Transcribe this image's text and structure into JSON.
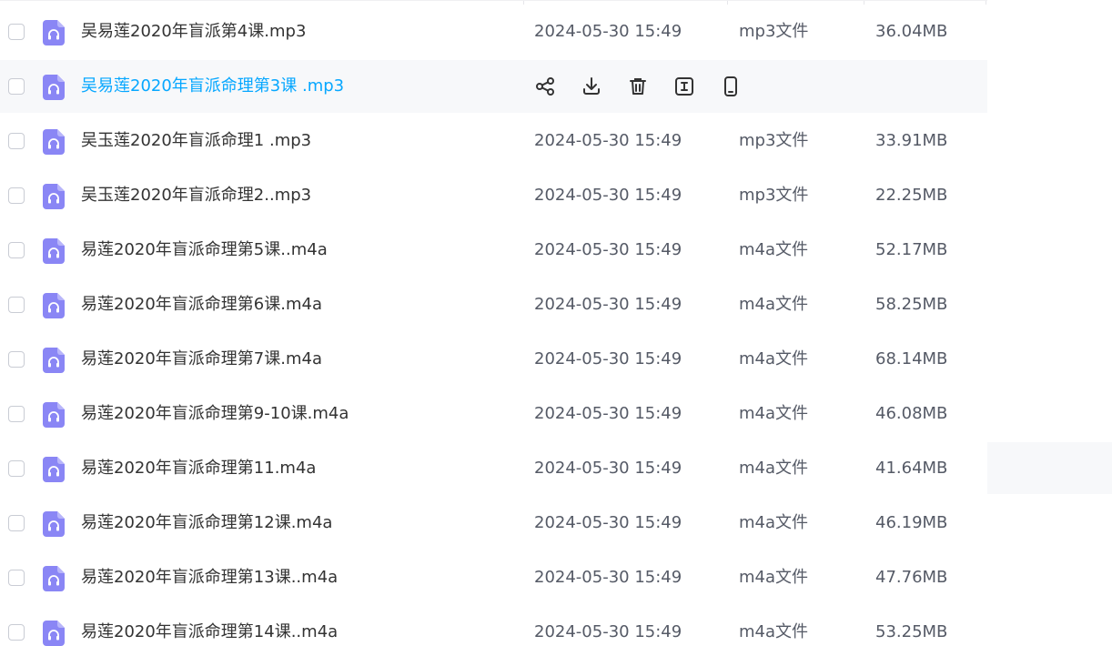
{
  "files": [
    {
      "name": "吴易莲2020年盲派第4课.mp3",
      "date": "2024-05-30 15:49",
      "type": "mp3文件",
      "size": "36.04MB"
    },
    {
      "name": "吴易莲2020年盲派命理第3课 .mp3",
      "date": "",
      "type": "",
      "size": ""
    },
    {
      "name": "吴玉莲2020年盲派命理1 .mp3",
      "date": "2024-05-30 15:49",
      "type": "mp3文件",
      "size": "33.91MB"
    },
    {
      "name": "吴玉莲2020年盲派命理2..mp3",
      "date": "2024-05-30 15:49",
      "type": "mp3文件",
      "size": "22.25MB"
    },
    {
      "name": "易莲2020年盲派命理第5课..m4a",
      "date": "2024-05-30 15:49",
      "type": "m4a文件",
      "size": "52.17MB"
    },
    {
      "name": "易莲2020年盲派命理第6课.m4a",
      "date": "2024-05-30 15:49",
      "type": "m4a文件",
      "size": "58.25MB"
    },
    {
      "name": "易莲2020年盲派命理第7课.m4a",
      "date": "2024-05-30 15:49",
      "type": "m4a文件",
      "size": "68.14MB"
    },
    {
      "name": "易莲2020年盲派命理第9-10课.m4a",
      "date": "2024-05-30 15:49",
      "type": "m4a文件",
      "size": "46.08MB"
    },
    {
      "name": "易莲2020年盲派命理第11.m4a",
      "date": "2024-05-30 15:49",
      "type": "m4a文件",
      "size": "41.64MB"
    },
    {
      "name": "易莲2020年盲派命理第12课.m4a",
      "date": "2024-05-30 15:49",
      "type": "m4a文件",
      "size": "46.19MB"
    },
    {
      "name": "易莲2020年盲派命理第13课..m4a",
      "date": "2024-05-30 15:49",
      "type": "m4a文件",
      "size": "47.76MB"
    },
    {
      "name": "易莲2020年盲派命理第14课..m4a",
      "date": "2024-05-30 15:49",
      "type": "m4a文件",
      "size": "53.25MB"
    }
  ],
  "hovered_row_actions": [
    "share-icon",
    "download-icon",
    "delete-icon",
    "rename-icon",
    "phone-icon"
  ],
  "colors": {
    "file_icon": "#8a86f5",
    "link_hover": "#06a7ff",
    "row_hover_bg": "#f7f8fa"
  }
}
